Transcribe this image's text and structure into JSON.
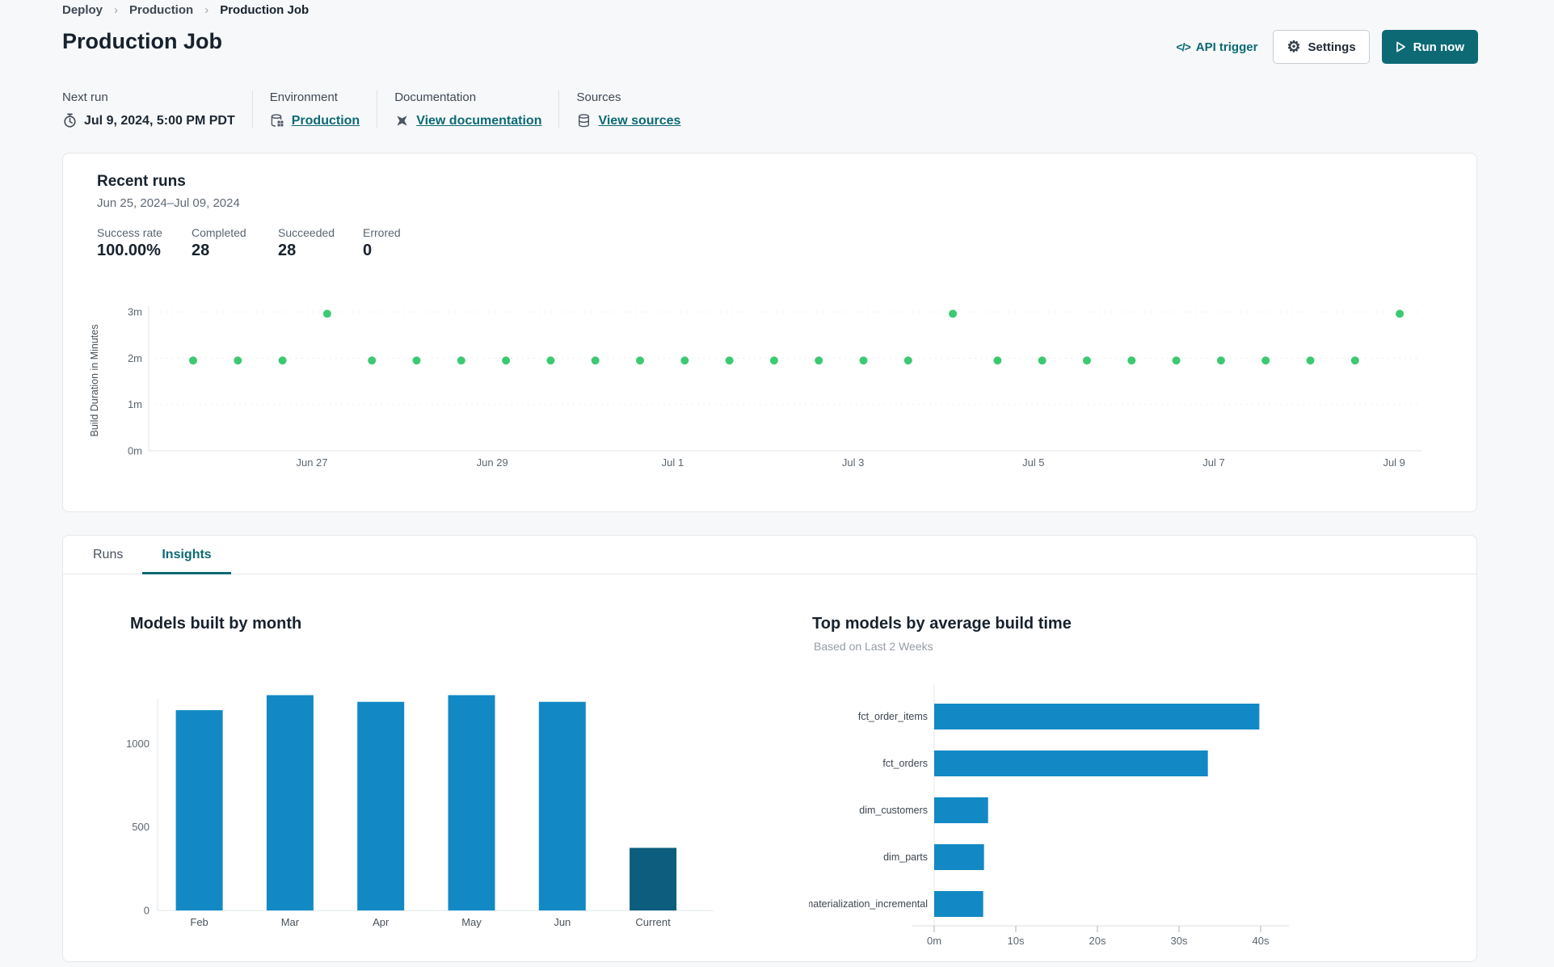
{
  "page": {
    "title": "Production Job"
  },
  "breadcrumb": {
    "items": [
      "Deploy",
      "Production",
      "Production Job"
    ],
    "separator": "›"
  },
  "actions": {
    "api_trigger_label": "API trigger",
    "api_trigger_glyph": "</>",
    "settings_label": "Settings",
    "run_now_label": "Run now",
    "icons": [
      "code-icon",
      "gear-icon",
      "play-icon"
    ]
  },
  "meta": {
    "columns": [
      {
        "label": "Next run",
        "value": "Jul 9, 2024, 5:00 PM PDT",
        "icon": "stopwatch-icon",
        "is_link": false
      },
      {
        "label": "Environment",
        "value": "Production",
        "icon": "environment-icon",
        "is_link": true
      },
      {
        "label": "Documentation",
        "value": "View documentation",
        "icon": "dbt-logo-icon",
        "is_link": true
      },
      {
        "label": "Sources",
        "value": "View sources",
        "icon": "database-icon",
        "is_link": true
      }
    ]
  },
  "recent_runs": {
    "title": "Recent runs",
    "date_range": "Jun 25, 2024–Jul 09, 2024",
    "stats": [
      {
        "label": "Success rate",
        "value": "100.00%"
      },
      {
        "label": "Completed",
        "value": "28"
      },
      {
        "label": "Succeeded",
        "value": "28"
      },
      {
        "label": "Errored",
        "value": "0"
      }
    ]
  },
  "tabs": [
    {
      "label": "Runs",
      "active": false
    },
    {
      "label": "Insights",
      "active": true
    }
  ],
  "colors": {
    "accent_teal": "#0d6a75",
    "run_dot_green": "#3dc973",
    "bar_blue": "#1289c5",
    "bar_dark_teal": "#0d5e7e",
    "page_background": "#f7f8f9",
    "card_border": "#e4e7ea"
  },
  "chart_data": [
    {
      "id": "build-duration-scatter",
      "type": "scatter",
      "ylabel": "Build Duration in Minutes",
      "y_ticks": [
        "0m",
        "1m",
        "2m",
        "3m"
      ],
      "x_ticks": [
        "Jun 27",
        "Jun 29",
        "Jul 1",
        "Jul 3",
        "Jul 5",
        "Jul 7",
        "Jul 9"
      ],
      "ylim_minutes": [
        0,
        3.26
      ],
      "grid": "dotted-horizontal",
      "point_color": "#3dc973",
      "runs_minutes": [
        1.95,
        1.95,
        1.95,
        2.96,
        1.95,
        1.95,
        1.95,
        1.95,
        1.95,
        1.95,
        1.95,
        1.95,
        1.95,
        1.95,
        1.95,
        1.95,
        1.95,
        2.96,
        1.95,
        1.95,
        1.95,
        1.95,
        1.95,
        1.95,
        1.95,
        1.95,
        1.95,
        2.96
      ]
    },
    {
      "id": "models-built-by-month",
      "type": "bar",
      "title": "Models built by month",
      "categories": [
        "Feb",
        "Mar",
        "Apr",
        "May",
        "Jun",
        "Current"
      ],
      "values": [
        1200,
        1290,
        1250,
        1290,
        1250,
        375
      ],
      "y_ticks": [
        0,
        500,
        1000
      ],
      "ylim": [
        0,
        1480
      ],
      "bar_color": "#1289c5",
      "highlight_color": "#0d5e7e",
      "highlight_index": 5
    },
    {
      "id": "top-models-by-average-build-time",
      "type": "bar-horizontal",
      "title": "Top models by average build time",
      "subtitle": "Based on Last 2 Weeks",
      "categories": [
        "fct_order_items",
        "fct_orders",
        "dim_customers",
        "dim_parts",
        "materialization_incremental"
      ],
      "values_seconds": [
        39.8,
        33.5,
        6.6,
        6.1,
        6.0
      ],
      "x_ticks": [
        "0m",
        "10s",
        "20s",
        "30s",
        "40s"
      ],
      "xlim_seconds": [
        0,
        44
      ],
      "bar_color": "#1289c5"
    }
  ]
}
